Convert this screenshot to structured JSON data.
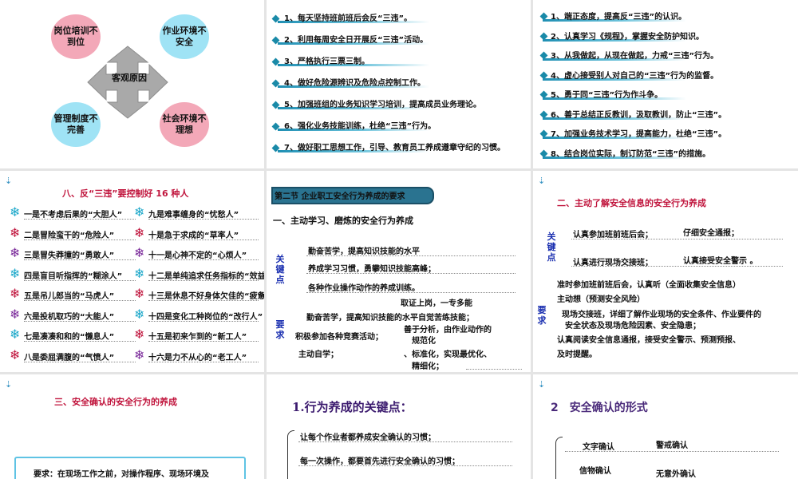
{
  "s1": {
    "c1": "岗位培训不到位",
    "c2": "作业环境不安全",
    "c3": "管理制度不完善",
    "c4": "社会环境不理想",
    "center": "客观原因"
  },
  "s2": {
    "items": [
      "1、每天坚持班前班后会反“三违”。",
      "2、利用每周安全日开展反“三违”活动。",
      "3、严格执行三票三制。",
      "4、做好危险源辨识及危险点控制工作。",
      "5、加强班组的业务知识学习培训，提高成员业务理论。",
      "6、强化业务技能训练，杜绝“三违”行为。",
      "7、做好职工思想工作，引导、教育员工养成遵章守纪的习惯。"
    ]
  },
  "s3": {
    "items": [
      "1、端正态度，提高反“三违”的认识。",
      "2、认真学习《规程》，掌握安全防护知识。",
      "3、从我做起，从现在做起，力戒“三违”行为。",
      "4、虚心接受别人对自己的“三违”行为的监督。",
      "5、勇于同“三违”行为作斗争。",
      "6、善于总结正反教训，汲取教训，防止“三违”。",
      "7、加强业务技术学习，提高能力，杜绝“三违”。",
      "8、结合岗位实际，制订防范“三违”的措施。"
    ]
  },
  "s4": {
    "title": "八、反“三违”要控制好 16 种人",
    "left": [
      "一是不考虑后果的“大胆人”",
      "二是冒险蛮干的“危险人”",
      "三是冒失莽撞的“勇敢人”",
      "四是盲目听指挥的“糊涂人”",
      "五是吊儿郎当的“马虎人”",
      "六是投机取巧的“大能人”",
      "七是凑凑和和的“懒息人”",
      "八是委屈满腹的“气愤人”"
    ],
    "right": [
      "九是难事缠身的“忧愁人”",
      "十是急于求成的“草率人”",
      "十一是心神不定的“心烦人”",
      "十二是单纯追求任务指标的“效益人”",
      "十三是休息不好身体欠佳的“疲惫人”",
      "十四是变化工种岗位的“改行人”",
      "十五是初来乍到的“新工人”",
      "十六是力不从心的“老工人”"
    ]
  },
  "s5": {
    "banner": "第二节 企业职工安全行为养成的要求",
    "heading": "一、主动学习、磨炼的安全行为养成",
    "tag1": "关键点",
    "tag2": "要求",
    "lines": [
      "勤奋苦学，提高知识技能的水平",
      "养成学习习惯，勇攀知识技能高峰；",
      "各种作业操作动作的养成训练。"
    ],
    "r1": "取证上岗，一专多能",
    "r2": "勤奋苦学，提高知识技能的水平自觉苦练技能；",
    "r3a": "善于分析，由作业动作的",
    "r3b": "规范化",
    "r4": "积极参加各种竞赛活动；",
    "r5": "主动自学；",
    "r6a": "、标准化，实现最优化、",
    "r6b": "精细化；"
  },
  "s6": {
    "title": "二、主动了解安全信息的安全行为养成",
    "tag1": "关键点",
    "tag2": "要求",
    "k1a": "认真参加班前班后会；",
    "k1b": "仔细安全通报；",
    "k2a": "认真进行现场交接班；",
    "k2b": "认真接受安全警示 。",
    "q1": "准时参加班前班后会，认真听（全面收集安全信息）",
    "q2": "主动想（预测安全风险）",
    "q3": "现场交接班，详细了解作业现场的安全条件、作业要件的",
    "q4": "安全状态及现场危险因素、安全隐患；",
    "q5": "认真阅读安全信息通报，接受安全警示、预测预报、",
    "q6": "及时提醒。"
  },
  "s7": {
    "title": "三、安全确认的安全行为的养成",
    "box": "要求：在现场工作之前，对操作程序、现场环境及"
  },
  "s8": {
    "title": "1.行为养成的关键点：",
    "l1": "让每个作业者都养成安全确认的习惯；",
    "l2": "每一次操作，都要首先进行安全确认的习惯；"
  },
  "s9": {
    "title": "2　安全确认的形式",
    "a1": "文字确认",
    "a2": "警戒确认",
    "a3": "信物确认",
    "a4": "无意外确认"
  }
}
